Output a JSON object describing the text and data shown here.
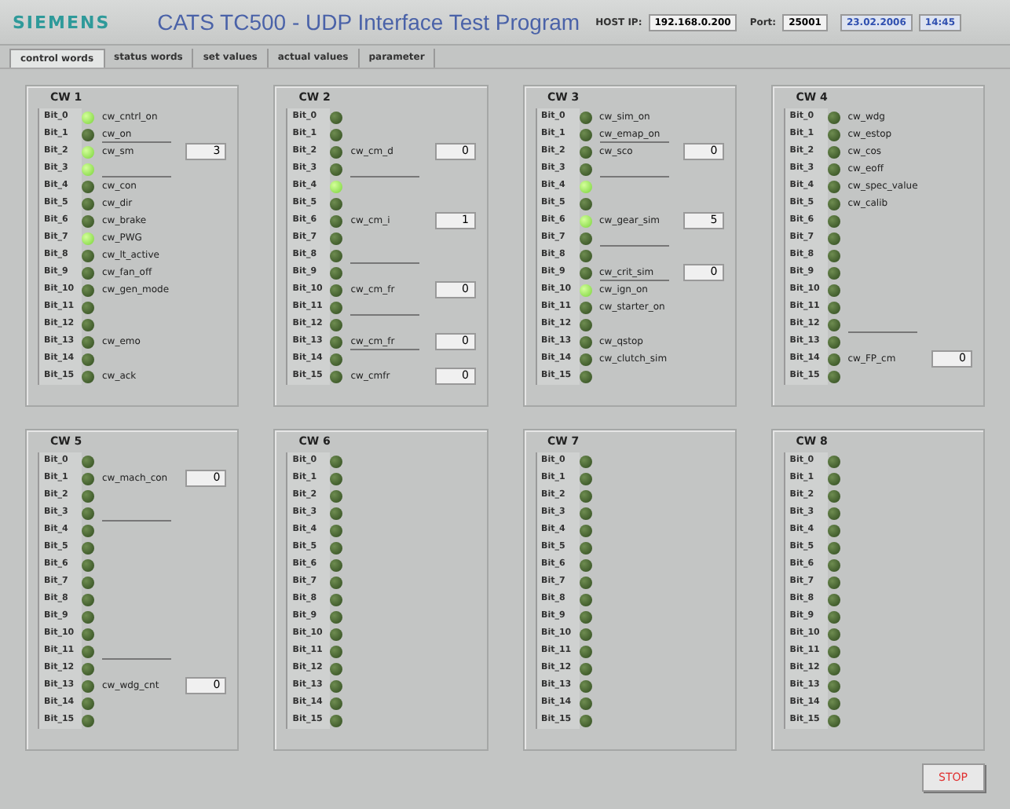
{
  "header": {
    "logo": "SIEMENS",
    "title": "CATS TC500 - UDP Interface Test Program",
    "host_label": "HOST IP:",
    "host_ip": "192.168.0.200",
    "port_label": "Port:",
    "port": "25001",
    "date": "23.02.2006",
    "time": "14:45"
  },
  "tabs": [
    {
      "label": "control words",
      "selected": true
    },
    {
      "label": "status words",
      "selected": false
    },
    {
      "label": "set values",
      "selected": false
    },
    {
      "label": "actual values",
      "selected": false
    },
    {
      "label": "parameter",
      "selected": false
    }
  ],
  "panels": [
    {
      "title": "CW 1",
      "rows": [
        {
          "bit": "Bit_0",
          "on": true,
          "signal": "cw_cntrl_on",
          "rule": false
        },
        {
          "bit": "Bit_1",
          "on": false,
          "signal": "cw_on",
          "rule": true
        },
        {
          "bit": "Bit_2",
          "on": true,
          "signal": "cw_sm",
          "value": "3",
          "rule": false
        },
        {
          "bit": "Bit_3",
          "on": true,
          "rule": true
        },
        {
          "bit": "Bit_4",
          "on": false,
          "signal": "cw_con",
          "rule": false
        },
        {
          "bit": "Bit_5",
          "on": false,
          "signal": "cw_dir",
          "rule": false
        },
        {
          "bit": "Bit_6",
          "on": false,
          "signal": "cw_brake",
          "rule": false
        },
        {
          "bit": "Bit_7",
          "on": true,
          "signal": "cw_PWG",
          "rule": false
        },
        {
          "bit": "Bit_8",
          "on": false,
          "signal": "cw_lt_active",
          "rule": false
        },
        {
          "bit": "Bit_9",
          "on": false,
          "signal": "cw_fan_off",
          "rule": false
        },
        {
          "bit": "Bit_10",
          "on": false,
          "signal": "cw_gen_mode",
          "rule": false
        },
        {
          "bit": "Bit_11",
          "on": false,
          "rule": false
        },
        {
          "bit": "Bit_12",
          "on": false,
          "rule": false
        },
        {
          "bit": "Bit_13",
          "on": false,
          "signal": "cw_emo",
          "rule": false
        },
        {
          "bit": "Bit_14",
          "on": false,
          "rule": false
        },
        {
          "bit": "Bit_15",
          "on": false,
          "signal": "cw_ack",
          "rule": false
        }
      ]
    },
    {
      "title": "CW 2",
      "rows": [
        {
          "bit": "Bit_0",
          "on": false,
          "rule": false
        },
        {
          "bit": "Bit_1",
          "on": false,
          "rule": false
        },
        {
          "bit": "Bit_2",
          "on": false,
          "signal": "cw_cm_d",
          "value": "0",
          "rule": false
        },
        {
          "bit": "Bit_3",
          "on": false,
          "rule": true
        },
        {
          "bit": "Bit_4",
          "on": true,
          "rule": false
        },
        {
          "bit": "Bit_5",
          "on": false,
          "rule": false
        },
        {
          "bit": "Bit_6",
          "on": false,
          "signal": "cw_cm_i",
          "value": "1",
          "rule": false
        },
        {
          "bit": "Bit_7",
          "on": false,
          "rule": false
        },
        {
          "bit": "Bit_8",
          "on": false,
          "rule": true
        },
        {
          "bit": "Bit_9",
          "on": false,
          "rule": false
        },
        {
          "bit": "Bit_10",
          "on": false,
          "signal": "cw_cm_fr",
          "value": "0",
          "rule": false
        },
        {
          "bit": "Bit_11",
          "on": false,
          "rule": true
        },
        {
          "bit": "Bit_12",
          "on": false,
          "rule": false
        },
        {
          "bit": "Bit_13",
          "on": false,
          "signal": "cw_cm_fr",
          "value": "0",
          "rule": true
        },
        {
          "bit": "Bit_14",
          "on": false,
          "rule": false
        },
        {
          "bit": "Bit_15",
          "on": false,
          "signal": "cw_cmfr",
          "value": "0",
          "rule": false
        }
      ]
    },
    {
      "title": "CW 3",
      "rows": [
        {
          "bit": "Bit_0",
          "on": false,
          "signal": "cw_sim_on",
          "rule": false
        },
        {
          "bit": "Bit_1",
          "on": false,
          "signal": "cw_emap_on",
          "rule": true
        },
        {
          "bit": "Bit_2",
          "on": false,
          "signal": "cw_sco",
          "value": "0",
          "rule": false
        },
        {
          "bit": "Bit_3",
          "on": false,
          "rule": true
        },
        {
          "bit": "Bit_4",
          "on": true,
          "rule": false
        },
        {
          "bit": "Bit_5",
          "on": false,
          "rule": false
        },
        {
          "bit": "Bit_6",
          "on": true,
          "signal": "cw_gear_sim",
          "value": "5",
          "rule": false
        },
        {
          "bit": "Bit_7",
          "on": false,
          "rule": true
        },
        {
          "bit": "Bit_8",
          "on": false,
          "rule": false
        },
        {
          "bit": "Bit_9",
          "on": false,
          "signal": "cw_crit_sim",
          "value": "0",
          "rule": true
        },
        {
          "bit": "Bit_10",
          "on": true,
          "signal": "cw_ign_on",
          "rule": false
        },
        {
          "bit": "Bit_11",
          "on": false,
          "signal": "cw_starter_on",
          "rule": false
        },
        {
          "bit": "Bit_12",
          "on": false,
          "rule": false
        },
        {
          "bit": "Bit_13",
          "on": false,
          "signal": "cw_qstop",
          "rule": false
        },
        {
          "bit": "Bit_14",
          "on": false,
          "signal": "cw_clutch_sim",
          "rule": false
        },
        {
          "bit": "Bit_15",
          "on": false,
          "rule": false
        }
      ]
    },
    {
      "title": "CW 4",
      "rows": [
        {
          "bit": "Bit_0",
          "on": false,
          "signal": "cw_wdg",
          "rule": false
        },
        {
          "bit": "Bit_1",
          "on": false,
          "signal": "cw_estop",
          "rule": false
        },
        {
          "bit": "Bit_2",
          "on": false,
          "signal": "cw_cos",
          "rule": false
        },
        {
          "bit": "Bit_3",
          "on": false,
          "signal": "cw_eoff",
          "rule": false
        },
        {
          "bit": "Bit_4",
          "on": false,
          "signal": "cw_spec_value",
          "rule": false
        },
        {
          "bit": "Bit_5",
          "on": false,
          "signal": "cw_calib",
          "rule": false
        },
        {
          "bit": "Bit_6",
          "on": false,
          "rule": false
        },
        {
          "bit": "Bit_7",
          "on": false,
          "rule": false
        },
        {
          "bit": "Bit_8",
          "on": false,
          "rule": false
        },
        {
          "bit": "Bit_9",
          "on": false,
          "rule": false
        },
        {
          "bit": "Bit_10",
          "on": false,
          "rule": false
        },
        {
          "bit": "Bit_11",
          "on": false,
          "rule": false
        },
        {
          "bit": "Bit_12",
          "on": false,
          "rule": true
        },
        {
          "bit": "Bit_13",
          "on": false,
          "rule": false
        },
        {
          "bit": "Bit_14",
          "on": false,
          "signal": "cw_FP_cm",
          "value": "0",
          "rule": false
        },
        {
          "bit": "Bit_15",
          "on": false,
          "rule": false
        }
      ]
    },
    {
      "title": "CW 5",
      "rows": [
        {
          "bit": "Bit_0",
          "on": false,
          "rule": false
        },
        {
          "bit": "Bit_1",
          "on": false,
          "signal": "cw_mach_con",
          "value": "0",
          "rule": false
        },
        {
          "bit": "Bit_2",
          "on": false,
          "rule": false
        },
        {
          "bit": "Bit_3",
          "on": false,
          "rule": true
        },
        {
          "bit": "Bit_4",
          "on": false,
          "rule": false
        },
        {
          "bit": "Bit_5",
          "on": false,
          "rule": false
        },
        {
          "bit": "Bit_6",
          "on": false,
          "rule": false
        },
        {
          "bit": "Bit_7",
          "on": false,
          "rule": false
        },
        {
          "bit": "Bit_8",
          "on": false,
          "rule": false
        },
        {
          "bit": "Bit_9",
          "on": false,
          "rule": false
        },
        {
          "bit": "Bit_10",
          "on": false,
          "rule": false
        },
        {
          "bit": "Bit_11",
          "on": false,
          "rule": true
        },
        {
          "bit": "Bit_12",
          "on": false,
          "rule": false
        },
        {
          "bit": "Bit_13",
          "on": false,
          "signal": "cw_wdg_cnt",
          "value": "0",
          "rule": false
        },
        {
          "bit": "Bit_14",
          "on": false,
          "rule": false
        },
        {
          "bit": "Bit_15",
          "on": false,
          "rule": false
        }
      ]
    },
    {
      "title": "CW 6",
      "rows": [
        {
          "bit": "Bit_0",
          "on": false,
          "rule": false
        },
        {
          "bit": "Bit_1",
          "on": false,
          "rule": false
        },
        {
          "bit": "Bit_2",
          "on": false,
          "rule": false
        },
        {
          "bit": "Bit_3",
          "on": false,
          "rule": false
        },
        {
          "bit": "Bit_4",
          "on": false,
          "rule": false
        },
        {
          "bit": "Bit_5",
          "on": false,
          "rule": false
        },
        {
          "bit": "Bit_6",
          "on": false,
          "rule": false
        },
        {
          "bit": "Bit_7",
          "on": false,
          "rule": false
        },
        {
          "bit": "Bit_8",
          "on": false,
          "rule": false
        },
        {
          "bit": "Bit_9",
          "on": false,
          "rule": false
        },
        {
          "bit": "Bit_10",
          "on": false,
          "rule": false
        },
        {
          "bit": "Bit_11",
          "on": false,
          "rule": false
        },
        {
          "bit": "Bit_12",
          "on": false,
          "rule": false
        },
        {
          "bit": "Bit_13",
          "on": false,
          "rule": false
        },
        {
          "bit": "Bit_14",
          "on": false,
          "rule": false
        },
        {
          "bit": "Bit_15",
          "on": false,
          "rule": false
        }
      ]
    },
    {
      "title": "CW 7",
      "rows": [
        {
          "bit": "Bit_0",
          "on": false,
          "rule": false
        },
        {
          "bit": "Bit_1",
          "on": false,
          "rule": false
        },
        {
          "bit": "Bit_2",
          "on": false,
          "rule": false
        },
        {
          "bit": "Bit_3",
          "on": false,
          "rule": false
        },
        {
          "bit": "Bit_4",
          "on": false,
          "rule": false
        },
        {
          "bit": "Bit_5",
          "on": false,
          "rule": false
        },
        {
          "bit": "Bit_6",
          "on": false,
          "rule": false
        },
        {
          "bit": "Bit_7",
          "on": false,
          "rule": false
        },
        {
          "bit": "Bit_8",
          "on": false,
          "rule": false
        },
        {
          "bit": "Bit_9",
          "on": false,
          "rule": false
        },
        {
          "bit": "Bit_10",
          "on": false,
          "rule": false
        },
        {
          "bit": "Bit_11",
          "on": false,
          "rule": false
        },
        {
          "bit": "Bit_12",
          "on": false,
          "rule": false
        },
        {
          "bit": "Bit_13",
          "on": false,
          "rule": false
        },
        {
          "bit": "Bit_14",
          "on": false,
          "rule": false
        },
        {
          "bit": "Bit_15",
          "on": false,
          "rule": false
        }
      ]
    },
    {
      "title": "CW 8",
      "rows": [
        {
          "bit": "Bit_0",
          "on": false,
          "rule": false
        },
        {
          "bit": "Bit_1",
          "on": false,
          "rule": false
        },
        {
          "bit": "Bit_2",
          "on": false,
          "rule": false
        },
        {
          "bit": "Bit_3",
          "on": false,
          "rule": false
        },
        {
          "bit": "Bit_4",
          "on": false,
          "rule": false
        },
        {
          "bit": "Bit_5",
          "on": false,
          "rule": false
        },
        {
          "bit": "Bit_6",
          "on": false,
          "rule": false
        },
        {
          "bit": "Bit_7",
          "on": false,
          "rule": false
        },
        {
          "bit": "Bit_8",
          "on": false,
          "rule": false
        },
        {
          "bit": "Bit_9",
          "on": false,
          "rule": false
        },
        {
          "bit": "Bit_10",
          "on": false,
          "rule": false
        },
        {
          "bit": "Bit_11",
          "on": false,
          "rule": false
        },
        {
          "bit": "Bit_12",
          "on": false,
          "rule": false
        },
        {
          "bit": "Bit_13",
          "on": false,
          "rule": false
        },
        {
          "bit": "Bit_14",
          "on": false,
          "rule": false
        },
        {
          "bit": "Bit_15",
          "on": false,
          "rule": false
        }
      ]
    }
  ],
  "stop_button": "STOP"
}
